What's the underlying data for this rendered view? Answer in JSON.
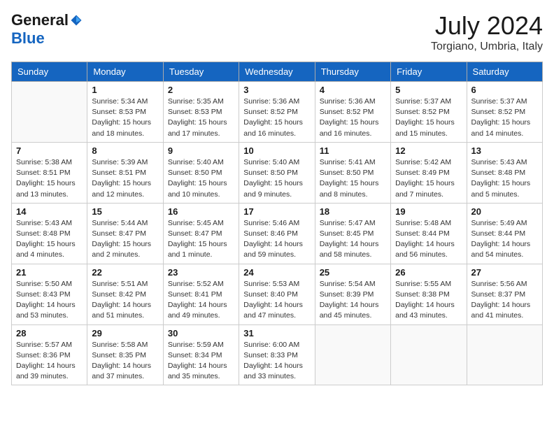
{
  "logo": {
    "general": "General",
    "blue": "Blue"
  },
  "title": {
    "month_year": "July 2024",
    "location": "Torgiano, Umbria, Italy"
  },
  "days_of_week": [
    "Sunday",
    "Monday",
    "Tuesday",
    "Wednesday",
    "Thursday",
    "Friday",
    "Saturday"
  ],
  "weeks": [
    [
      {
        "day": "",
        "info": ""
      },
      {
        "day": "1",
        "info": "Sunrise: 5:34 AM\nSunset: 8:53 PM\nDaylight: 15 hours\nand 18 minutes."
      },
      {
        "day": "2",
        "info": "Sunrise: 5:35 AM\nSunset: 8:53 PM\nDaylight: 15 hours\nand 17 minutes."
      },
      {
        "day": "3",
        "info": "Sunrise: 5:36 AM\nSunset: 8:52 PM\nDaylight: 15 hours\nand 16 minutes."
      },
      {
        "day": "4",
        "info": "Sunrise: 5:36 AM\nSunset: 8:52 PM\nDaylight: 15 hours\nand 16 minutes."
      },
      {
        "day": "5",
        "info": "Sunrise: 5:37 AM\nSunset: 8:52 PM\nDaylight: 15 hours\nand 15 minutes."
      },
      {
        "day": "6",
        "info": "Sunrise: 5:37 AM\nSunset: 8:52 PM\nDaylight: 15 hours\nand 14 minutes."
      }
    ],
    [
      {
        "day": "7",
        "info": "Sunrise: 5:38 AM\nSunset: 8:51 PM\nDaylight: 15 hours\nand 13 minutes."
      },
      {
        "day": "8",
        "info": "Sunrise: 5:39 AM\nSunset: 8:51 PM\nDaylight: 15 hours\nand 12 minutes."
      },
      {
        "day": "9",
        "info": "Sunrise: 5:40 AM\nSunset: 8:50 PM\nDaylight: 15 hours\nand 10 minutes."
      },
      {
        "day": "10",
        "info": "Sunrise: 5:40 AM\nSunset: 8:50 PM\nDaylight: 15 hours\nand 9 minutes."
      },
      {
        "day": "11",
        "info": "Sunrise: 5:41 AM\nSunset: 8:50 PM\nDaylight: 15 hours\nand 8 minutes."
      },
      {
        "day": "12",
        "info": "Sunrise: 5:42 AM\nSunset: 8:49 PM\nDaylight: 15 hours\nand 7 minutes."
      },
      {
        "day": "13",
        "info": "Sunrise: 5:43 AM\nSunset: 8:48 PM\nDaylight: 15 hours\nand 5 minutes."
      }
    ],
    [
      {
        "day": "14",
        "info": "Sunrise: 5:43 AM\nSunset: 8:48 PM\nDaylight: 15 hours\nand 4 minutes."
      },
      {
        "day": "15",
        "info": "Sunrise: 5:44 AM\nSunset: 8:47 PM\nDaylight: 15 hours\nand 2 minutes."
      },
      {
        "day": "16",
        "info": "Sunrise: 5:45 AM\nSunset: 8:47 PM\nDaylight: 15 hours\nand 1 minute."
      },
      {
        "day": "17",
        "info": "Sunrise: 5:46 AM\nSunset: 8:46 PM\nDaylight: 14 hours\nand 59 minutes."
      },
      {
        "day": "18",
        "info": "Sunrise: 5:47 AM\nSunset: 8:45 PM\nDaylight: 14 hours\nand 58 minutes."
      },
      {
        "day": "19",
        "info": "Sunrise: 5:48 AM\nSunset: 8:44 PM\nDaylight: 14 hours\nand 56 minutes."
      },
      {
        "day": "20",
        "info": "Sunrise: 5:49 AM\nSunset: 8:44 PM\nDaylight: 14 hours\nand 54 minutes."
      }
    ],
    [
      {
        "day": "21",
        "info": "Sunrise: 5:50 AM\nSunset: 8:43 PM\nDaylight: 14 hours\nand 53 minutes."
      },
      {
        "day": "22",
        "info": "Sunrise: 5:51 AM\nSunset: 8:42 PM\nDaylight: 14 hours\nand 51 minutes."
      },
      {
        "day": "23",
        "info": "Sunrise: 5:52 AM\nSunset: 8:41 PM\nDaylight: 14 hours\nand 49 minutes."
      },
      {
        "day": "24",
        "info": "Sunrise: 5:53 AM\nSunset: 8:40 PM\nDaylight: 14 hours\nand 47 minutes."
      },
      {
        "day": "25",
        "info": "Sunrise: 5:54 AM\nSunset: 8:39 PM\nDaylight: 14 hours\nand 45 minutes."
      },
      {
        "day": "26",
        "info": "Sunrise: 5:55 AM\nSunset: 8:38 PM\nDaylight: 14 hours\nand 43 minutes."
      },
      {
        "day": "27",
        "info": "Sunrise: 5:56 AM\nSunset: 8:37 PM\nDaylight: 14 hours\nand 41 minutes."
      }
    ],
    [
      {
        "day": "28",
        "info": "Sunrise: 5:57 AM\nSunset: 8:36 PM\nDaylight: 14 hours\nand 39 minutes."
      },
      {
        "day": "29",
        "info": "Sunrise: 5:58 AM\nSunset: 8:35 PM\nDaylight: 14 hours\nand 37 minutes."
      },
      {
        "day": "30",
        "info": "Sunrise: 5:59 AM\nSunset: 8:34 PM\nDaylight: 14 hours\nand 35 minutes."
      },
      {
        "day": "31",
        "info": "Sunrise: 6:00 AM\nSunset: 8:33 PM\nDaylight: 14 hours\nand 33 minutes."
      },
      {
        "day": "",
        "info": ""
      },
      {
        "day": "",
        "info": ""
      },
      {
        "day": "",
        "info": ""
      }
    ]
  ]
}
